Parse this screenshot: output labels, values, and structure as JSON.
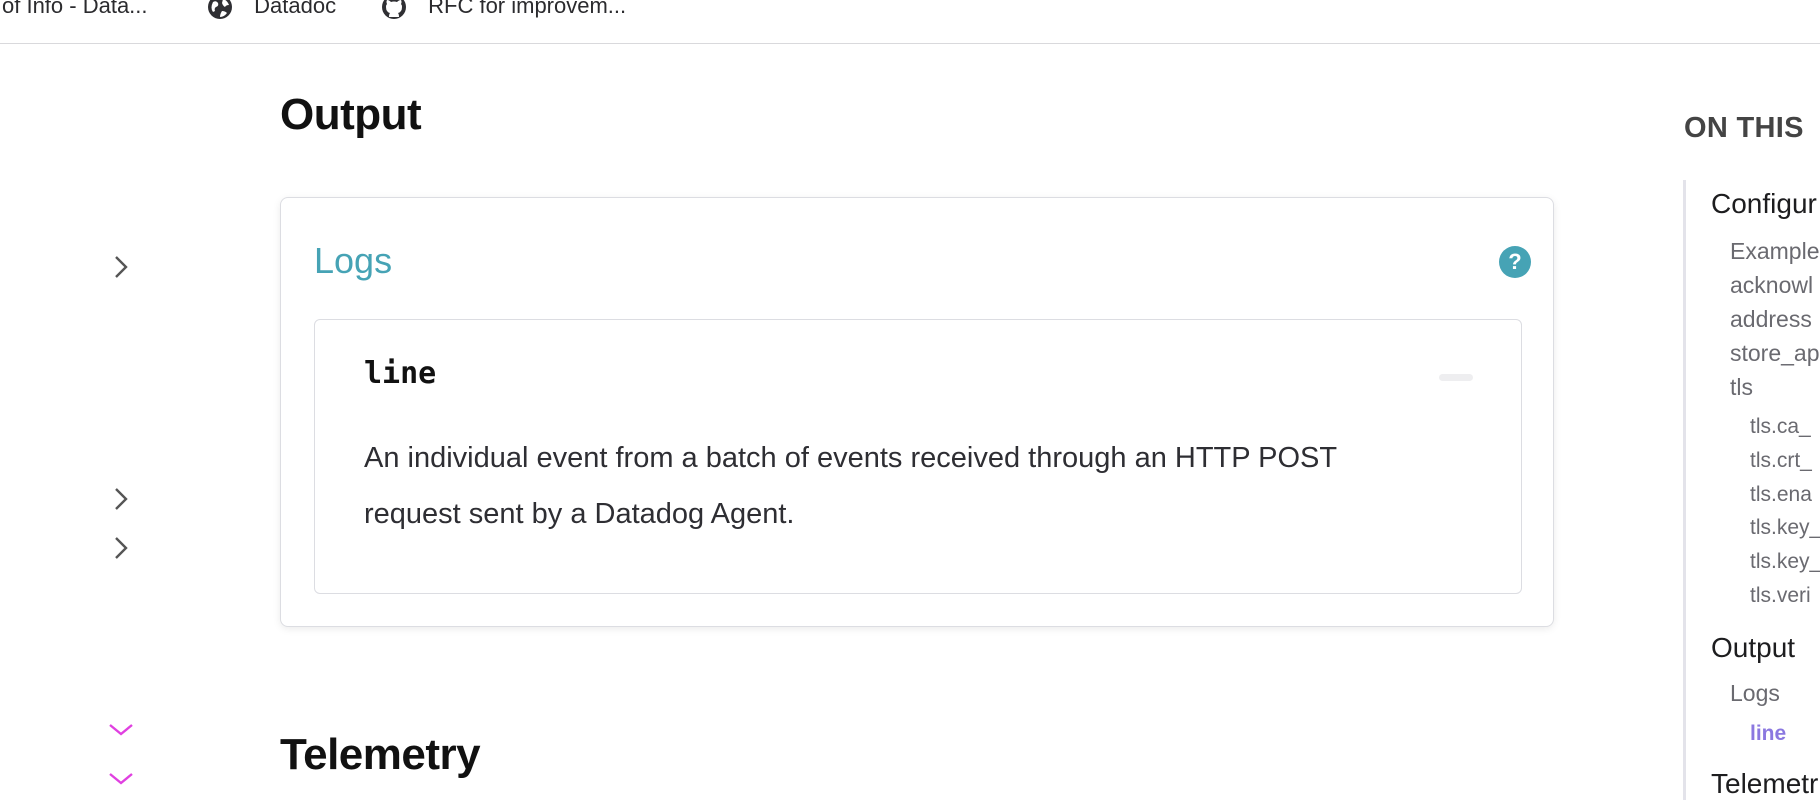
{
  "bookmarks": [
    {
      "label": "of Info - Data...",
      "icon": "none"
    },
    {
      "label": "Datadoc",
      "icon": "globe-icon"
    },
    {
      "label": "RFC for improvem...",
      "icon": "github-icon"
    }
  ],
  "main": {
    "output_heading": "Output",
    "telemetry_heading": "Telemetry",
    "logs_card": {
      "title": "Logs",
      "help_glyph": "?",
      "field": {
        "name": "line",
        "description": "An individual event from a batch of events received through an HTTP POST request sent by a Datadog Agent."
      }
    }
  },
  "toc": {
    "heading": "ON THIS",
    "items": [
      {
        "label": "Configur",
        "level": 1
      },
      {
        "label": "Example",
        "level": 2
      },
      {
        "label": "acknowl",
        "level": 2
      },
      {
        "label": "address",
        "level": 2
      },
      {
        "label": "store_ap",
        "level": 2
      },
      {
        "label": "tls",
        "level": 2
      },
      {
        "label": "tls.ca_",
        "level": 3
      },
      {
        "label": "tls.crt_",
        "level": 3
      },
      {
        "label": "tls.ena",
        "level": 3
      },
      {
        "label": "tls.key_",
        "level": 3
      },
      {
        "label": "tls.key_",
        "level": 3
      },
      {
        "label": "tls.veri",
        "level": 3
      },
      {
        "label": "Output",
        "level": 1
      },
      {
        "label": "Logs",
        "level": 2
      },
      {
        "label": "line",
        "level": 3,
        "active": true
      },
      {
        "label": "Telemetr",
        "level": 1
      }
    ]
  },
  "colors": {
    "accent_teal": "#46a3b5",
    "active_purple": "#8b78e0",
    "expanded_chevron": "#e040e0"
  }
}
